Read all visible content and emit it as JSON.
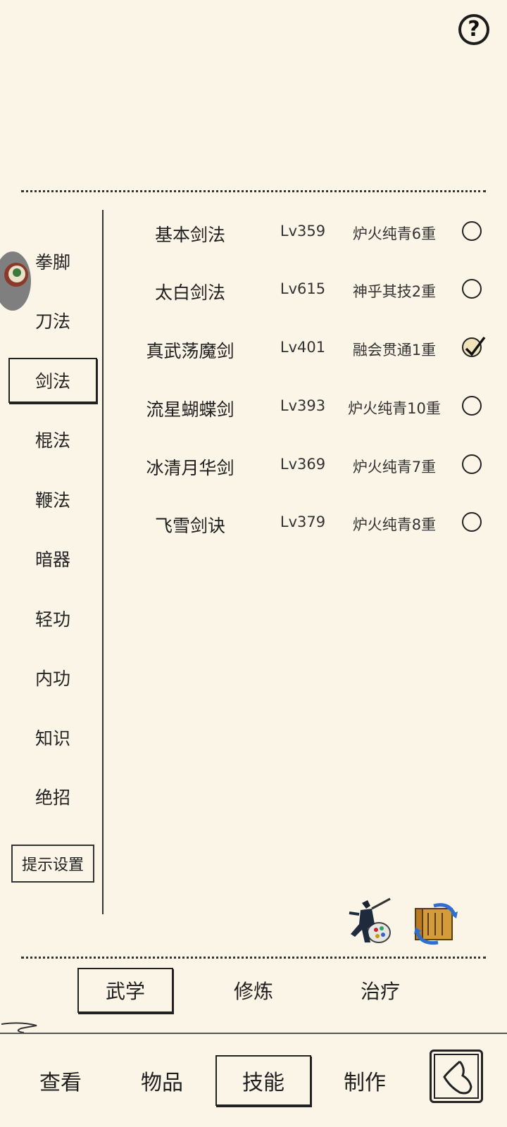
{
  "help": {
    "icon": "help-icon",
    "label": "?"
  },
  "categories": [
    {
      "label": "拳脚",
      "active": false
    },
    {
      "label": "刀法",
      "active": false
    },
    {
      "label": "剑法",
      "active": true
    },
    {
      "label": "棍法",
      "active": false
    },
    {
      "label": "鞭法",
      "active": false
    },
    {
      "label": "暗器",
      "active": false
    },
    {
      "label": "轻功",
      "active": false
    },
    {
      "label": "内功",
      "active": false
    },
    {
      "label": "知识",
      "active": false
    },
    {
      "label": "绝招",
      "active": false
    }
  ],
  "tip_settings": "提示设置",
  "skills": [
    {
      "name": "基本剑法",
      "level": "Lv359",
      "rank": "炉火纯青6重",
      "selected": false
    },
    {
      "name": "太白剑法",
      "level": "Lv615",
      "rank": "神乎其技2重",
      "selected": false
    },
    {
      "name": "真武荡魔剑",
      "level": "Lv401",
      "rank": "融会贯通1重",
      "selected": true
    },
    {
      "name": "流星蝴蝶剑",
      "level": "Lv393",
      "rank": "炉火纯青10重",
      "selected": false
    },
    {
      "name": "冰清月华剑",
      "level": "Lv369",
      "rank": "炉火纯青7重",
      "selected": false
    },
    {
      "name": "飞雪剑诀",
      "level": "Lv379",
      "rank": "炉火纯青8重",
      "selected": false
    }
  ],
  "subtabs": [
    {
      "label": "武学",
      "active": true
    },
    {
      "label": "修炼",
      "active": false
    },
    {
      "label": "治疗",
      "active": false
    }
  ],
  "nav": [
    {
      "label": "查看",
      "active": false
    },
    {
      "label": "物品",
      "active": false
    },
    {
      "label": "技能",
      "active": true
    },
    {
      "label": "制作",
      "active": false
    }
  ],
  "icons": {
    "warrior": "warrior-palette-icon",
    "scroll": "scroll-refresh-icon",
    "back": "back-arrow-icon"
  }
}
